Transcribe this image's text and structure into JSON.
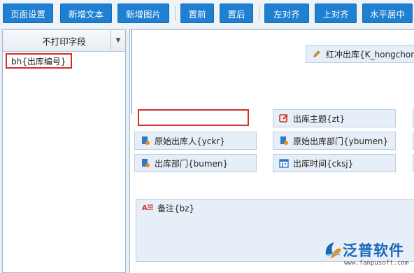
{
  "toolbar": {
    "buttons": [
      "页面设置",
      "新增文本",
      "新增图片",
      "置前",
      "置后",
      "左对齐",
      "上对齐",
      "水平居中"
    ]
  },
  "left_panel": {
    "header": "不打印字段",
    "dropdown_glyph": "▼",
    "items": [
      "bh{出库编号}"
    ]
  },
  "canvas": {
    "top_field": "红冲出库{K_hongchon",
    "fields": {
      "subject": "出库主题{zt}",
      "orig_person": "原始出库人{yckr}",
      "orig_dept": "原始出库部门{ybumen}",
      "dept": "出库部门{bumen}",
      "time": "出库时间{cksj}",
      "memo": "备注{bz}"
    }
  },
  "logo": {
    "name": "泛普软件",
    "url": "www.fanpusoft.com"
  },
  "colors": {
    "toolbar_button": "#1f7fd0",
    "highlight_red": "#d52b2b",
    "field_bg": "#e6eff8"
  }
}
